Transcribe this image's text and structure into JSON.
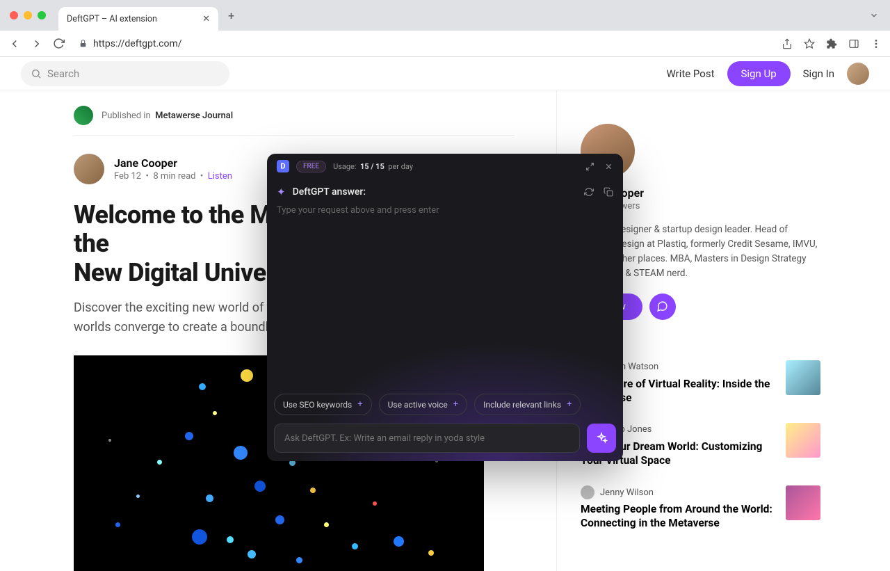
{
  "browser": {
    "tab_title": "DeftGPT – AI extension",
    "url": "https://deftgpt.com/"
  },
  "header": {
    "search_placeholder": "Search",
    "write_post": "Write Post",
    "sign_up": "Sign Up",
    "sign_in": "Sign In"
  },
  "publication": {
    "prefix": "Published in",
    "name": "Metawerse Journal"
  },
  "author": {
    "name": "Jane Cooper",
    "date": "Feb 12",
    "read": "8 min read",
    "listen": "Listen"
  },
  "article": {
    "title_line1": "Welcome to the Metaverse: Exploring the",
    "title_line2": "New Digital Universe",
    "lead": "Discover the exciting new world of the Metaverse, where virtual and physical worlds converge to create a boundless universe of exploration and creativity."
  },
  "sidebar": {
    "name": "Jane Cooper",
    "followers": "2.5K Followers",
    "bio": "Product designer & startup design leader. Head of Product Design at Plastiq, formerly Credit Sesame, IMVU, & a few other places. MBA, Masters in Design Strategy from CCA, & STEAM nerd.",
    "follow": "Follow"
  },
  "related": [
    {
      "author": "Kristin Watson",
      "title": "The Future of Virtual Reality: Inside the Metaverse"
    },
    {
      "author": "Jacob Jones",
      "title": "Build Your Dream World: Customizing Your Virtual Space"
    },
    {
      "author": "Jenny Wilson",
      "title": "Meeting People from Around the World: Connecting in the Metaverse"
    }
  ],
  "deft": {
    "free": "FREE",
    "usage_label": "Usage:",
    "usage_value": "15 / 15",
    "usage_unit": "per day",
    "header": "DeftGPT answer:",
    "body_placeholder": "Type your request above and press enter",
    "chips": [
      "Use SEO keywords",
      "Use active voice",
      "Include relevant links"
    ],
    "input_placeholder": "Ask DeftGPT. Ex: Write an email reply in yoda style"
  }
}
